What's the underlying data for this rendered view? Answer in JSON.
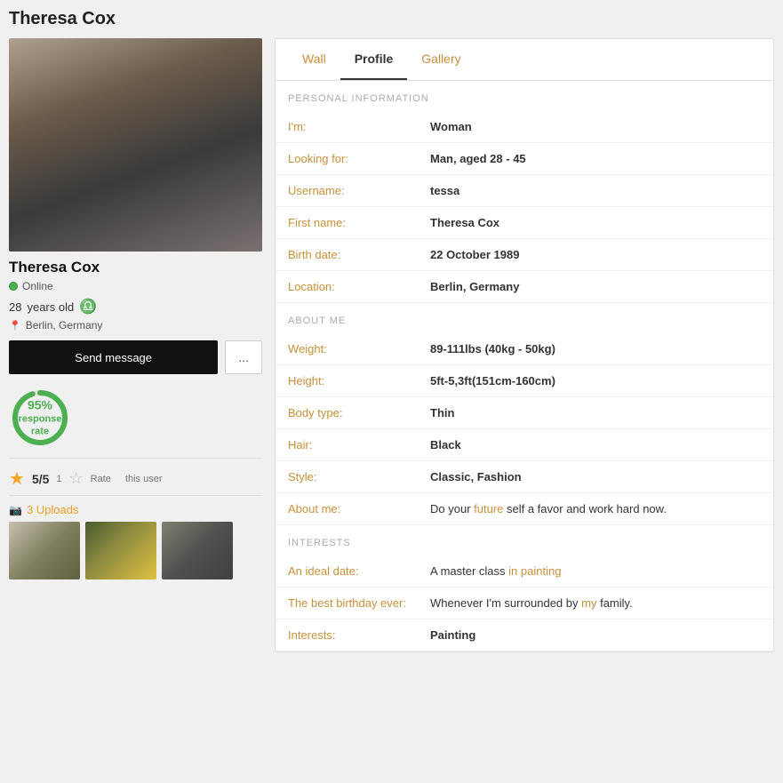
{
  "page": {
    "title": "Theresa Cox"
  },
  "tabs": [
    {
      "id": "wall",
      "label": "Wall",
      "active": false
    },
    {
      "id": "profile",
      "label": "Profile",
      "active": true
    },
    {
      "id": "gallery",
      "label": "Gallery",
      "active": false
    }
  ],
  "user": {
    "name": "Theresa Cox",
    "status": "Online",
    "age": "28",
    "age_suffix": "years old",
    "zodiac": "♎",
    "location": "Berlin, Germany",
    "send_message_label": "Send message",
    "more_label": "...",
    "response_pct": "95%",
    "response_label": "response",
    "response_sub": "rate",
    "rating_value": "5/5",
    "rating_count": "1",
    "rate_label": "Rate",
    "rate_sub": "this user",
    "uploads_count": "3 Uploads"
  },
  "personal_info": {
    "section_title": "PERSONAL INFORMATION",
    "rows": [
      {
        "label": "I'm:",
        "value": "Woman"
      },
      {
        "label": "Looking for:",
        "value": "Man, aged 28 - 45"
      },
      {
        "label": "Username:",
        "value": "tessa"
      },
      {
        "label": "First name:",
        "value": "Theresa Cox"
      },
      {
        "label": "Birth date:",
        "value": "22 October 1989"
      },
      {
        "label": "Location:",
        "value": "Berlin, Germany"
      }
    ]
  },
  "about_me": {
    "section_title": "ABOUT ME",
    "rows": [
      {
        "label": "Weight:",
        "value": "89-111lbs (40kg - 50kg)"
      },
      {
        "label": "Height:",
        "value": "5ft-5,3ft(151cm-160cm)"
      },
      {
        "label": "Body type:",
        "value": "Thin"
      },
      {
        "label": "Hair:",
        "value": "Black"
      },
      {
        "label": "Style:",
        "value": "Classic, Fashion"
      },
      {
        "label": "About me:",
        "value_parts": [
          {
            "text": "Do your ",
            "highlight": false
          },
          {
            "text": "future",
            "highlight": true
          },
          {
            "text": " self a favor and work hard now.",
            "highlight": false
          }
        ]
      }
    ]
  },
  "interests": {
    "section_title": "INTERESTS",
    "rows": [
      {
        "label": "An ideal date:",
        "value_parts": [
          {
            "text": "A master class ",
            "highlight": false
          },
          {
            "text": "in",
            "highlight": true
          },
          {
            "text": " ",
            "highlight": false
          },
          {
            "text": "painting",
            "highlight": true
          }
        ]
      },
      {
        "label": "The best birthday ever:",
        "value_parts": [
          {
            "text": "Whenever I'm surrounded by ",
            "highlight": false
          },
          {
            "text": "my",
            "highlight": true
          },
          {
            "text": " family.",
            "highlight": false
          }
        ]
      },
      {
        "label": "Interests:",
        "value": "Painting",
        "bold": true
      }
    ]
  }
}
